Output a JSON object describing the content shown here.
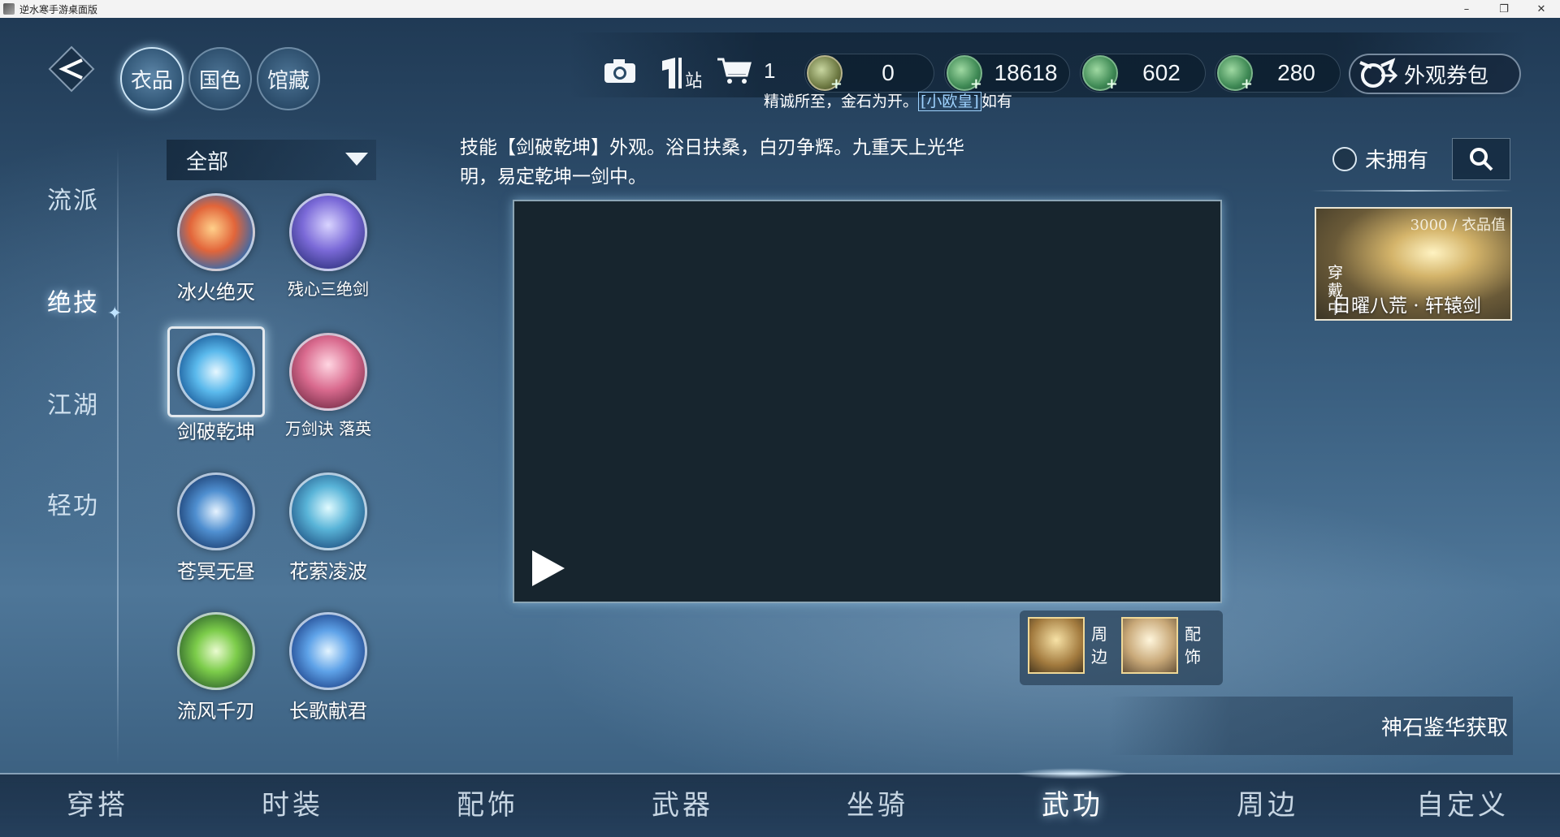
{
  "window": {
    "title": "逆水寒手游桌面版",
    "minimize": "–",
    "maximize": "❐",
    "close": "✕"
  },
  "top_tabs": [
    {
      "label": "衣品",
      "active": true
    },
    {
      "label": "国色",
      "active": false
    },
    {
      "label": "馆藏",
      "active": false
    }
  ],
  "top_icons": [
    "camera-icon",
    "wardrobe-station-icon",
    "cart-icon"
  ],
  "cart_count": "1",
  "currencies": [
    {
      "icon": "bag-coin-icon",
      "value": "0"
    },
    {
      "icon": "jade-coin-icon",
      "value": "18618"
    },
    {
      "icon": "jade-coin-icon",
      "value": "602"
    },
    {
      "icon": "jade-coin-icon",
      "value": "280"
    }
  ],
  "voucher_button": "外观券包",
  "ticker": {
    "prefix": "精诚所至，金石为开。",
    "highlight": "[小欧皇]",
    "suffix": "如有"
  },
  "categories": [
    {
      "label": "流派",
      "active": false
    },
    {
      "label": "绝技",
      "active": true
    },
    {
      "label": "江湖",
      "active": false
    },
    {
      "label": "轻功",
      "active": false
    }
  ],
  "filter": {
    "selected": "全部"
  },
  "skills": [
    {
      "name": "冰火绝灭",
      "selected": false
    },
    {
      "name": "残心三绝剑",
      "selected": false
    },
    {
      "name": "剑破乾坤",
      "selected": true
    },
    {
      "name": "万剑诀 落英",
      "selected": false
    },
    {
      "name": "苍冥无昼",
      "selected": false
    },
    {
      "name": "花萦凌波",
      "selected": false
    },
    {
      "name": "流风千刃",
      "selected": false
    },
    {
      "name": "长歌献君",
      "selected": false
    }
  ],
  "description": "技能【剑破乾坤】外观。浴日扶桑，白刃争辉。九重天上光华明，易定乾坤一剑中。",
  "accessories": [
    {
      "label": "周边"
    },
    {
      "label": "配饰"
    }
  ],
  "ownership_filter": "未拥有",
  "equipped": {
    "value": "3000 / 衣品值",
    "status": "穿戴中",
    "name": "日曜八荒 · 轩辕剑"
  },
  "acquire_link": "神石鉴华获取",
  "bottom_tabs": [
    {
      "label": "穿搭",
      "active": false
    },
    {
      "label": "时装",
      "active": false
    },
    {
      "label": "配饰",
      "active": false
    },
    {
      "label": "武器",
      "active": false
    },
    {
      "label": "坐骑",
      "active": false
    },
    {
      "label": "武功",
      "active": true
    },
    {
      "label": "周边",
      "active": false
    },
    {
      "label": "自定义",
      "active": false
    }
  ]
}
